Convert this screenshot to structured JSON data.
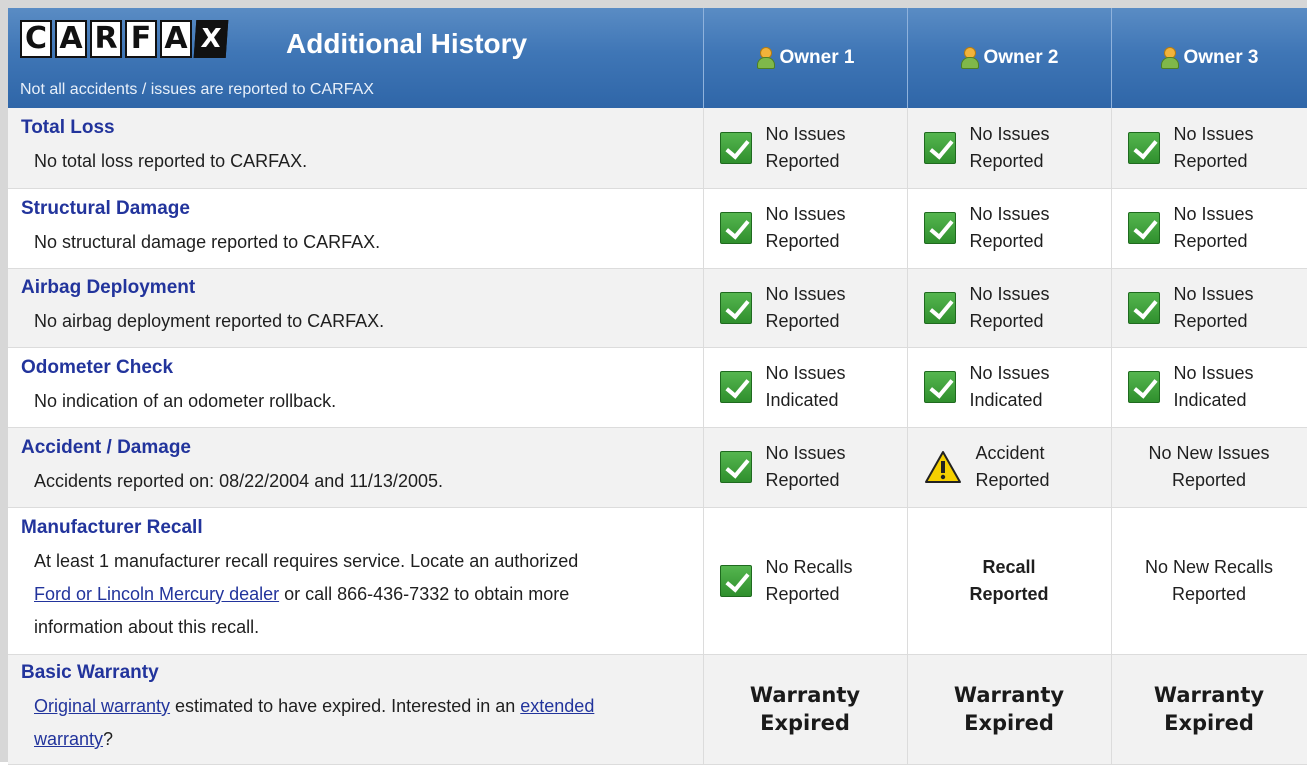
{
  "header": {
    "logo_letters": [
      "C",
      "A",
      "R",
      "F",
      "A",
      "X"
    ],
    "title": "Additional History",
    "subtitle": "Not all accidents / issues are reported to CARFAX",
    "owners": [
      "Owner 1",
      "Owner 2",
      "Owner 3"
    ]
  },
  "rows": [
    {
      "title": "Total Loss",
      "desc": "No total loss reported to CARFAX.",
      "o1": {
        "line1": "No Issues",
        "line2": "Reported"
      },
      "o2": {
        "line1": "No Issues",
        "line2": "Reported"
      },
      "o3": {
        "line1": "No Issues",
        "line2": "Reported"
      }
    },
    {
      "title": "Structural Damage",
      "desc": "No structural damage reported to CARFAX.",
      "o1": {
        "line1": "No Issues",
        "line2": "Reported"
      },
      "o2": {
        "line1": "No Issues",
        "line2": "Reported"
      },
      "o3": {
        "line1": "No Issues",
        "line2": "Reported"
      }
    },
    {
      "title": "Airbag Deployment",
      "desc": "No airbag deployment reported to CARFAX.",
      "o1": {
        "line1": "No Issues",
        "line2": "Reported"
      },
      "o2": {
        "line1": "No Issues",
        "line2": "Reported"
      },
      "o3": {
        "line1": "No Issues",
        "line2": "Reported"
      }
    },
    {
      "title": "Odometer Check",
      "desc": "No indication of an odometer rollback.",
      "o1": {
        "line1": "No Issues",
        "line2": "Indicated"
      },
      "o2": {
        "line1": "No Issues",
        "line2": "Indicated"
      },
      "o3": {
        "line1": "No Issues",
        "line2": "Indicated"
      }
    },
    {
      "title": "Accident / Damage",
      "desc": "Accidents reported on: 08/22/2004 and 11/13/2005.",
      "o1": {
        "line1": "No Issues",
        "line2": "Reported"
      },
      "o2": {
        "line1": "Accident",
        "line2": "Reported"
      },
      "o3": {
        "line1": "No New Issues",
        "line2": "Reported"
      }
    },
    {
      "title": "Manufacturer Recall",
      "desc_part1": "At least 1 manufacturer recall requires service. Locate an authorized",
      "desc_link": "Ford or Lincoln Mercury dealer",
      "desc_part2": " or call 866-436-7332 to obtain more",
      "desc_part3": "information about this recall.",
      "o1": {
        "line1": "No Recalls",
        "line2": "Reported"
      },
      "o2": {
        "line1": "Recall",
        "line2": "Reported"
      },
      "o3": {
        "line1": "No New Recalls",
        "line2": "Reported"
      }
    },
    {
      "title": "Basic Warranty",
      "desc_link1": "Original warranty",
      "desc_part1": " estimated to have expired. Interested in an ",
      "desc_link2": "extended",
      "desc_link2b": "warranty",
      "desc_end": "?",
      "o1": {
        "line1": "Warranty",
        "line2": "Expired"
      },
      "o2": {
        "line1": "Warranty",
        "line2": "Expired"
      },
      "o3": {
        "line1": "Warranty",
        "line2": "Expired"
      }
    }
  ],
  "icons": {
    "pass": "green-check-icon",
    "alert": "warning-triangle-icon",
    "owner": "person-icon"
  },
  "colors": {
    "header_blue": "#3f76b6",
    "link_blue": "#22349c",
    "check_green": "#3aa336",
    "warning_yellow": "#f5d000"
  }
}
